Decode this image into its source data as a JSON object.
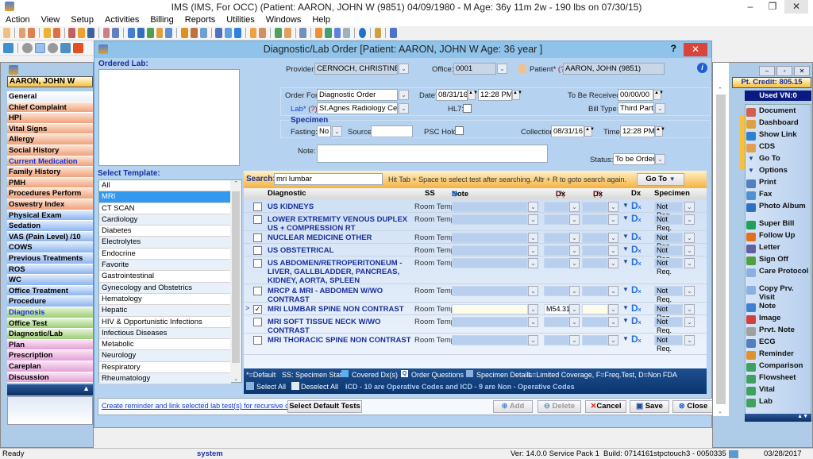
{
  "app": {
    "title": "IMS (IMS, For OCC)    (Patient: AARON, JOHN W (9851) 04/09/1980 - M Age: 36y 11m 2w - 190 lbs on 07/30/15)",
    "window_controls": {
      "minimize": "–",
      "maximize": "❐",
      "close": "✕"
    }
  },
  "menu": [
    "Action",
    "View",
    "Setup",
    "Activities",
    "Billing",
    "Reports",
    "Utilities",
    "Windows",
    "Help"
  ],
  "left_panel": {
    "patient_name": "AARON, JOHN W",
    "items": [
      {
        "label": "General",
        "style": "white"
      },
      {
        "label": "Chief Complaint",
        "style": "orange"
      },
      {
        "label": "HPI",
        "style": "orange"
      },
      {
        "label": "Vital Signs",
        "style": "orange"
      },
      {
        "label": "Allergy",
        "style": "orange"
      },
      {
        "label": "Social History",
        "style": "orange"
      },
      {
        "label": "Current Medication",
        "style": "orange",
        "highlight": true
      },
      {
        "label": "Family History",
        "style": "orange"
      },
      {
        "label": "PMH",
        "style": "orange"
      },
      {
        "label": "Procedures Perform",
        "style": "orange"
      },
      {
        "label": "Oswestry Index",
        "style": "orange"
      },
      {
        "label": "Physical Exam",
        "style": "blue"
      },
      {
        "label": "Sedation",
        "style": "blue"
      },
      {
        "label": "VAS (Pain Level)  /10",
        "style": "blue"
      },
      {
        "label": "COWS",
        "style": "blue"
      },
      {
        "label": "Previous Treatments",
        "style": "blue"
      },
      {
        "label": "ROS",
        "style": "blue"
      },
      {
        "label": "WC",
        "style": "blue"
      },
      {
        "label": "Office Treatment",
        "style": "blue"
      },
      {
        "label": "Procedure",
        "style": "blue"
      },
      {
        "label": "Diagnosis",
        "style": "green",
        "highlight": true
      },
      {
        "label": "Office Test",
        "style": "green"
      },
      {
        "label": "Diagnostic/Lab",
        "style": "green"
      },
      {
        "label": "Plan",
        "style": "pink"
      },
      {
        "label": "Prescription",
        "style": "pink"
      },
      {
        "label": "Careplan",
        "style": "pink"
      },
      {
        "label": "Discussion",
        "style": "pink"
      }
    ]
  },
  "dialog": {
    "title": "Diagnostic/Lab Order  [Patient: AARON, JOHN W  Age: 36 year ]",
    "help": "?",
    "close": "✕",
    "ordered_lab_label": "Ordered Lab:",
    "provider_label": "Provider*",
    "provider_value": "CERNOCH, CHRISTINE",
    "office_label": "Office:",
    "office_value": "0001",
    "patient_label": "Patient*",
    "patient_help": "(?)",
    "patient_value": "AARON, JOHN  (9851)",
    "order_for_label": "Order For*",
    "order_for_value": "Diagnostic Order",
    "date_label": "Date*",
    "date_value": "08/31/16",
    "time_value": "12:28 PM",
    "to_be_received_label": "To Be Received:",
    "to_be_received_value": "00/00/00",
    "lab_label": "Lab*",
    "lab_help": "(?)",
    "lab_value": "St.Agnes Radiology Center",
    "hl7_label": "HL7:",
    "bill_type_label": "Bill Type:",
    "bill_type_value": "Third Party",
    "specimen_title": "Specimen",
    "fasting_label": "Fasting:",
    "fasting_value": "No",
    "source_label": "Source:",
    "source_value": "",
    "psc_hold_label": "PSC Hold:",
    "collection_label": "Collection:",
    "collection_value": "08/31/16",
    "time_label": "Time:",
    "collection_time_value": "12:28 PM",
    "note_label": "Note:",
    "note_value": "",
    "status_label": "Status:",
    "status_value": "To be Ordered",
    "template": {
      "title": "Select Template:",
      "items": [
        "All",
        "MRI",
        "CT SCAN",
        "Cardiology",
        "Diabetes",
        "Electrolytes",
        "Endocrine",
        "Favorite",
        "Gastrointestinal",
        "Gynecology and Obstetrics",
        "Hematology",
        "Hepatic",
        "HIV & Opportunistic Infections",
        "Infectious Diseases",
        "Metabolic",
        "Neurology",
        "Respiratory",
        "Rheumatology"
      ],
      "selected": "MRI"
    },
    "search": {
      "label": "Search:",
      "value": "mri lumbar",
      "hint": "Hit Tab + Space to select test after searching. Altr + R to goto search again.",
      "goto_label": "Go To"
    },
    "grid": {
      "headers": {
        "diagnostic": "Diagnostic",
        "ss": "SS",
        "note": "Note",
        "dx1": "Dx (1)",
        "dx2": "Dx (2)",
        "help": "(?)",
        "dx": "Dx",
        "specimen": "Specimen"
      },
      "rows": [
        {
          "name": "US KIDNEYS",
          "ss": "Room Temp.",
          "dx1": "",
          "specimen": "Not Req.",
          "checked": false
        },
        {
          "name": "LOWER EXTREMITY VENOUS DUPLEX US + COMPRESSION RT",
          "ss": "Room Temp.",
          "dx1": "",
          "specimen": "Not Req.",
          "checked": false
        },
        {
          "name": "NUCLEAR MEDICINE OTHER",
          "ss": "Room Temp.",
          "dx1": "",
          "specimen": "Not Req.",
          "checked": false
        },
        {
          "name": "US OBSTETRICAL",
          "ss": "Room Temp.",
          "dx1": "",
          "specimen": "Not Req.",
          "checked": false
        },
        {
          "name": "US ABDOMEN/RETROPERITONEUM - LIVER, GALLBLADDER, PANCREAS, KIDNEY, AORTA, SPLEEN",
          "ss": "Room Temp.",
          "dx1": "",
          "specimen": "Not Req.",
          "checked": false
        },
        {
          "name": "MRCP & MRI - ABDOMEN W/WO CONTRAST",
          "ss": "Room Temp.",
          "dx1": "",
          "specimen": "Not Req.",
          "checked": false
        },
        {
          "name": "MRI LUMBAR SPINE NON CONTRAST",
          "ss": "Room Temp.",
          "dx1": "M54.31",
          "specimen": "Not Req.",
          "checked": true
        },
        {
          "name": "MRI SOFT TISSUE NECK W/WO CONTRAST",
          "ss": "Room Temp.",
          "dx1": "",
          "specimen": "Not Req.",
          "checked": false
        },
        {
          "name": "MRI THORACIC SPINE NON CONTRAST",
          "ss": "Room Temp.",
          "dx1": "",
          "specimen": "Not Req.",
          "checked": false
        }
      ]
    },
    "legend": {
      "default": "*=Default",
      "ss": "SS: Specimen State",
      "covered": "Covered Dx(s)",
      "questions": "Order Questions",
      "specimen_details": "Specimen Details",
      "codes": "L=Limited Coverage, F=Freq.Test, D=Non FDA",
      "select_all": "Select All",
      "deselect_all": "Deselect All",
      "icd_note": "ICD - 10 are Operative Codes and ICD - 9 are Non - Operative Codes"
    },
    "bottom": {
      "link": "Create reminder and link selected lab test(s) for recursive order.",
      "select_default": "Select Default Tests",
      "add": "Add",
      "delete": "Delete",
      "cancel": "Cancel",
      "save": "Save",
      "close": "Close"
    }
  },
  "right_panel": {
    "credit": "Pt. Credit: 805.15",
    "used_vn": "Used VN:0",
    "items": [
      "Document",
      "Dashboard",
      "Show Link",
      "CDS",
      "Go To",
      "Options",
      "Print",
      "Fax",
      "Photo Album",
      "Super Bill",
      "Follow Up",
      "Letter",
      "Sign Off",
      "Care Protocol",
      "Copy Prv. Visit",
      "Note",
      "Image",
      "Prvt. Note",
      "ECG",
      "Reminder",
      "Comparison",
      "Flowsheet",
      "Vital",
      "Lab"
    ]
  },
  "status": {
    "ready": "Ready",
    "user": "system",
    "version": "Ver: 14.0.0 Service Pack 1",
    "build": "Build: 071416",
    "machine": "1stpctouch3 - 0050335",
    "date": "03/28/2017"
  }
}
